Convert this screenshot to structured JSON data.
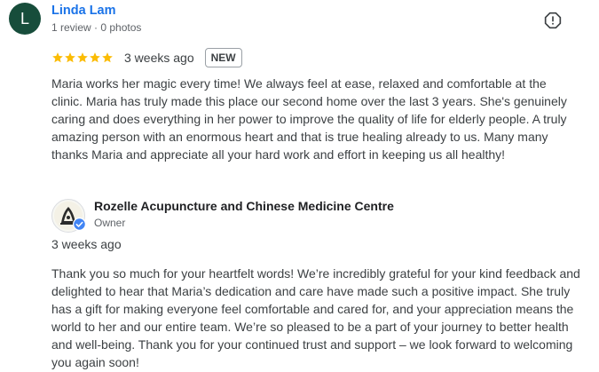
{
  "review": {
    "avatar_letter": "L",
    "avatar_color": "#174d3b",
    "reviewer_name": "Linda Lam",
    "reviewer_meta": "1 review · 0 photos",
    "rating": 5,
    "star_color": "#fbbc04",
    "date": "3 weeks ago",
    "badge": "NEW",
    "report_icon": "report-icon",
    "text": "Maria works her magic every time! We always feel at ease, relaxed and comfortable at the clinic. Maria has truly made this place our second home over the last 3 years. She's genuinely caring and does everything in her power to improve the quality of life for elderly people. A truly amazing person with an enormous heart and that is true healing already to us. Many many thanks Maria and appreciate all your hard work and effort in keeping us all healthy!"
  },
  "owner_reply": {
    "business_name": "Rozelle Acupuncture and Chinese Medicine Centre",
    "role": "Owner",
    "verified_icon": "verified-check-icon",
    "verified_color": "#4285f4",
    "date": "3 weeks ago",
    "text": "Thank you so much for your heartfelt words! We’re incredibly grateful for your kind feedback and delighted to hear that Maria’s dedication and care have made such a positive impact. She truly has a gift for making everyone feel comfortable and cared for, and your appreciation means the world to her and our entire team. We’re so pleased to be a part of your journey to better health and well-being. Thank you for your continued trust and support – we look forward to welcoming you again soon!"
  }
}
